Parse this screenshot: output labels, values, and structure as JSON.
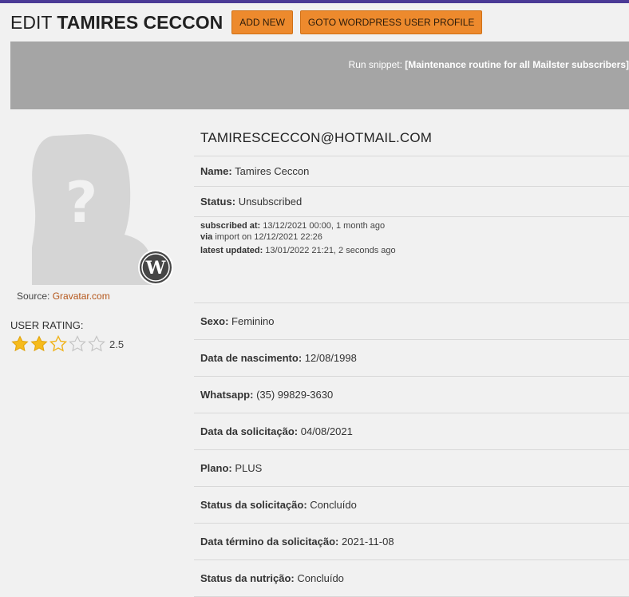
{
  "header": {
    "title_prefix": "EDIT",
    "title_name": "TAMIRES CECCON",
    "add_new_label": "ADD NEW",
    "goto_profile_label": "GOTO WORDPRESS USER PROFILE"
  },
  "snippet": {
    "prefix": "Run snippet: ",
    "name": "[Maintenance routine for all Mailster subscribers]"
  },
  "avatar": {
    "source_label": "Source: ",
    "source_link": "Gravatar.com"
  },
  "rating": {
    "label": "USER RATING:",
    "value": "2.5",
    "max_stars": 5,
    "filled_stars": 2
  },
  "profile": {
    "email": "TAMIRESCECCON@HOTMAIL.COM",
    "name_label": "Name:",
    "name_value": "Tamires Ceccon",
    "status_label": "Status:",
    "status_value": "Unsubscribed",
    "subscribed_at_label": "subscribed at:",
    "subscribed_at_value": "13/12/2021 00:00, 1 month ago",
    "via_label": "via",
    "via_value": "import on 12/12/2021 22:26",
    "latest_updated_label": "latest updated:",
    "latest_updated_value": "13/01/2022 21:21, 2 seconds ago"
  },
  "fields": [
    {
      "label": "Sexo:",
      "value": "Feminino"
    },
    {
      "label": "Data de nascimento:",
      "value": "12/08/1998"
    },
    {
      "label": "Whatsapp:",
      "value": "(35) 99829-3630"
    },
    {
      "label": "Data da solicitação:",
      "value": "04/08/2021"
    },
    {
      "label": "Plano:",
      "value": "PLUS"
    },
    {
      "label": "Status da solicitação:",
      "value": "Concluído"
    },
    {
      "label": "Data término da solicitação:",
      "value": "2021-11-08"
    },
    {
      "label": "Status da nutrição:",
      "value": "Concluído"
    }
  ],
  "colors": {
    "button": "#ed8a2d",
    "snippet_bar": "#a5a5a5",
    "star": "#f6bb1c",
    "link": "#b45519"
  }
}
